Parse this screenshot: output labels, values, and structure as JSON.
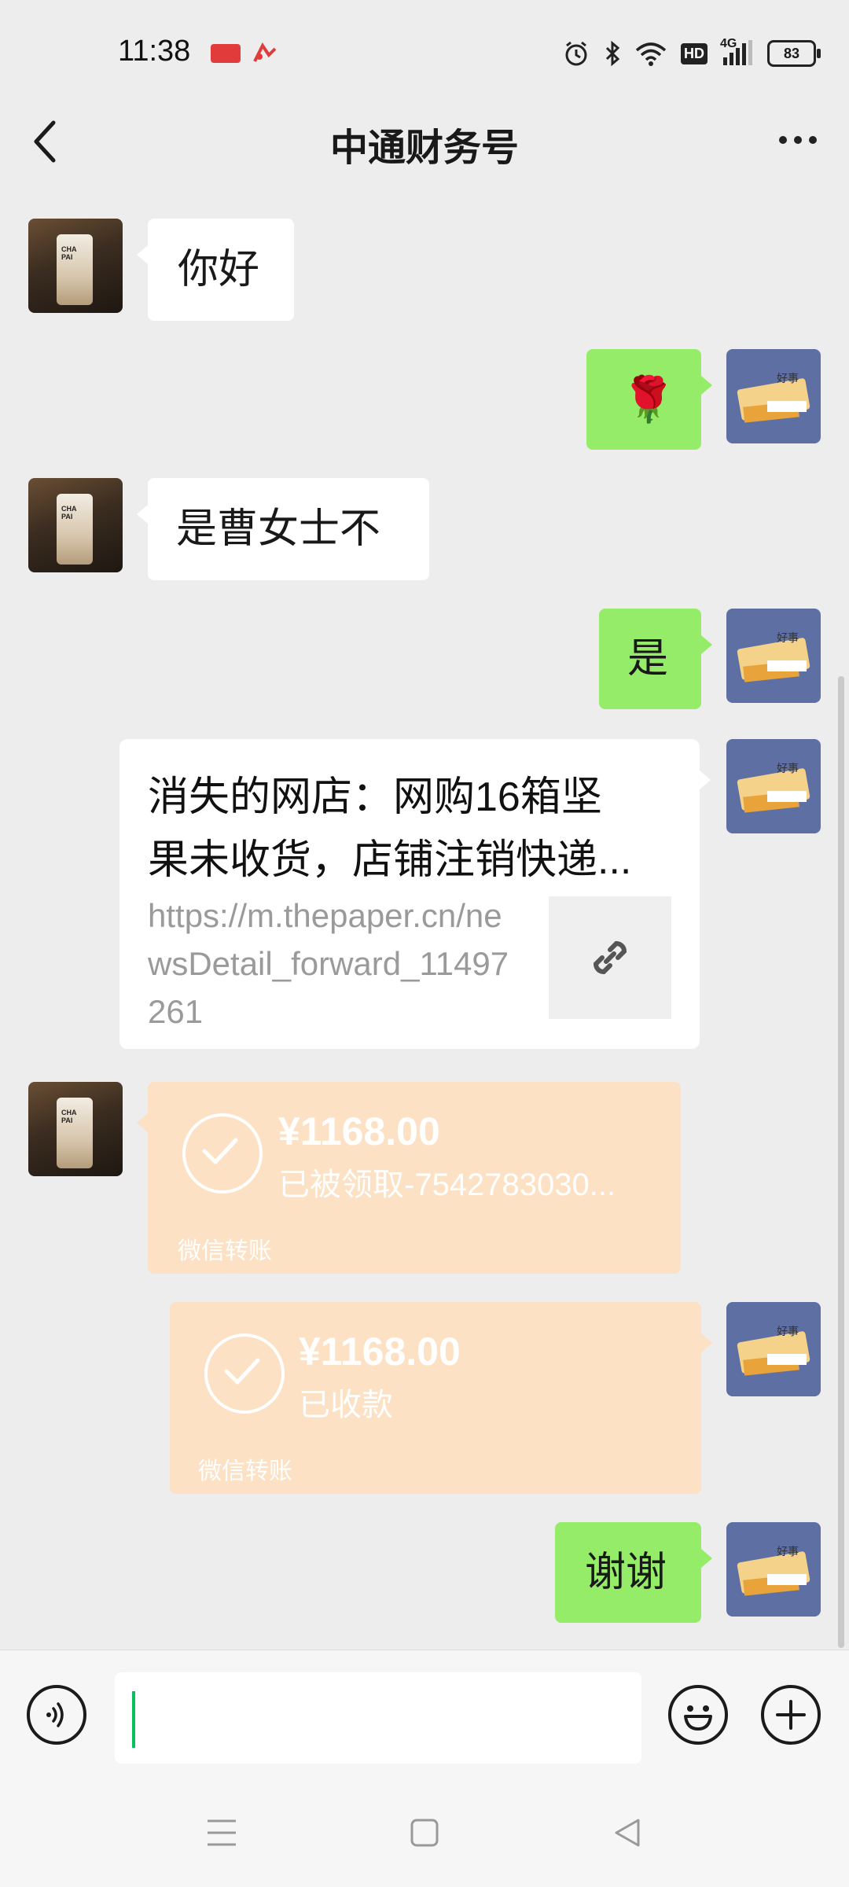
{
  "status_bar": {
    "time": "11:38",
    "hd_label": "HD",
    "network_label": "4G",
    "battery_level": "83"
  },
  "header": {
    "title": "中通财务号",
    "back_icon": "chevron-left-icon",
    "more_icon": "more-horizontal-icon"
  },
  "messages": {
    "m1_text": "你好",
    "m2_emoji": "🌹",
    "m3_text": "是曹女士不",
    "m4_text": "是",
    "m9_text": "谢谢"
  },
  "link_card": {
    "title_line1": "消失的网店：网购16箱坚",
    "title_line2": "果未收货，店铺注销快递...",
    "url": "https://m.thepaper.cn/newsDetail_forward_11497261",
    "thumb_icon": "link-icon"
  },
  "transfer_received": {
    "amount": "¥1168.00",
    "status": "已被领取-7542783030...",
    "label": "微信转账"
  },
  "transfer_collected": {
    "amount": "¥1168.00",
    "status": "已收款",
    "label": "微信转账"
  },
  "input_bar": {
    "voice_icon": "voice-icon",
    "emoji_icon": "emoji-icon",
    "plus_icon": "plus-icon",
    "input_value": ""
  },
  "colors": {
    "bubble_sent": "#95ec69",
    "bubble_received": "#ffffff",
    "transfer": "#fde1c4",
    "background": "#ededed",
    "caret": "#07c160"
  }
}
